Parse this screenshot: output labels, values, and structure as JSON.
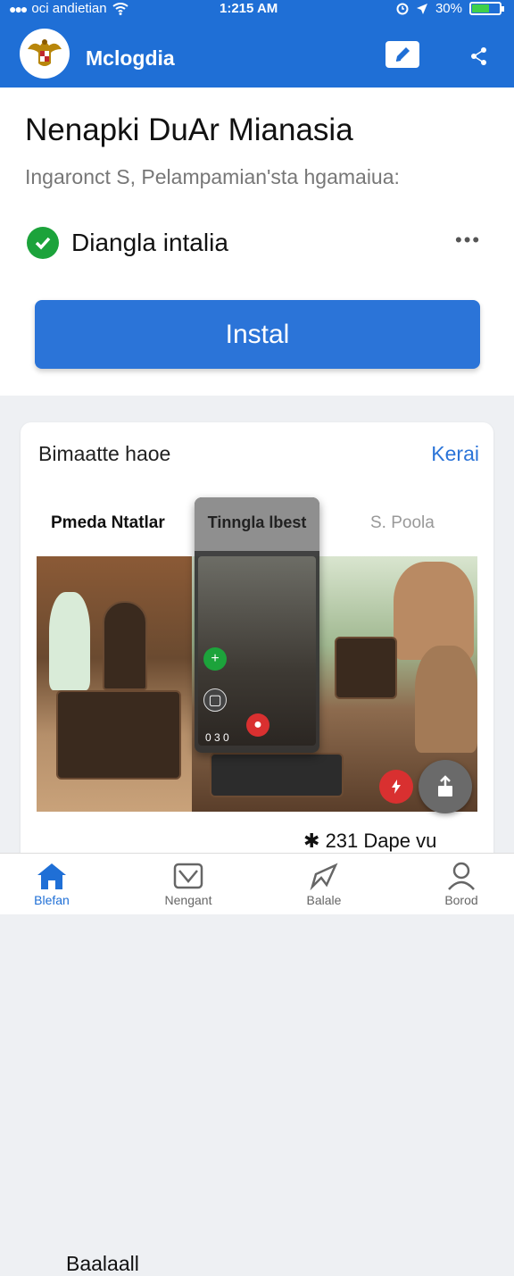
{
  "status_bar": {
    "carrier": "oci andietian",
    "time": "1:215 AM",
    "battery": "30%"
  },
  "app_bar": {
    "app_name": "Mclogdia"
  },
  "header": {
    "title": "Nenapki DuAr Mianasia",
    "subtitle": "Ingaronct S, Pelampamian'sta  hgamaiua:",
    "status": "Diangla intalia",
    "install_label": "Instal"
  },
  "card": {
    "title": "Bimaatte haoe",
    "link": "Kerai",
    "tabs": [
      {
        "label": "Pmeda Ntatlar"
      },
      {
        "label": "Tinngla lbest"
      },
      {
        "label": "S. Poola"
      }
    ],
    "overlay_count": "0 3 0",
    "footer_left": "Baalaall",
    "footer_right": "231 Dape vu"
  },
  "bottom_nav": [
    {
      "label": "Blefan",
      "icon": "home-icon",
      "active": true
    },
    {
      "label": "Nengant",
      "icon": "mail-icon",
      "active": false
    },
    {
      "label": "Balale",
      "icon": "send-icon",
      "active": false
    },
    {
      "label": "Borod",
      "icon": "profile-icon",
      "active": false
    }
  ],
  "colors": {
    "primary": "#1f6fd6",
    "button": "#2b74d8",
    "success": "#1ca33b",
    "danger": "#d93030"
  }
}
